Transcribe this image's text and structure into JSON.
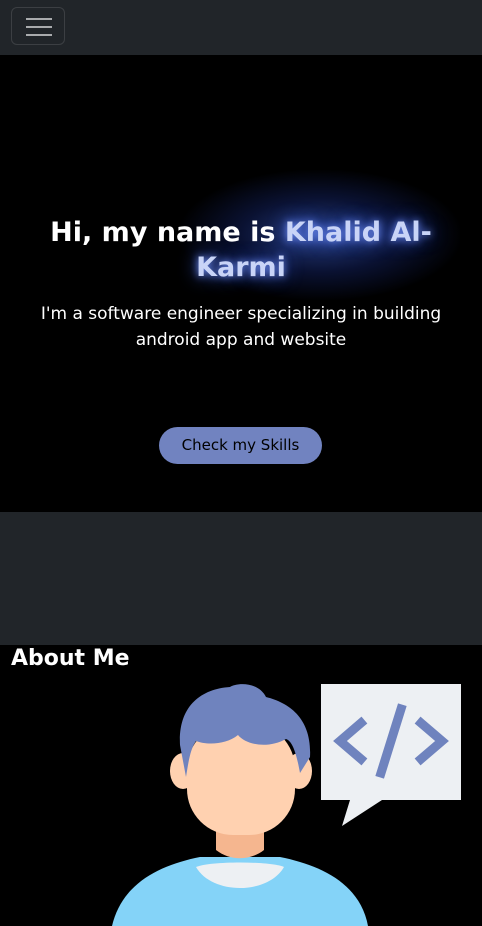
{
  "navbar": {
    "toggler_icon": "hamburger-menu-icon"
  },
  "hero": {
    "title_prefix": "Hi, my name is",
    "title_name": "Khalid Al-Karmi",
    "subtitle": "I'm a software engineer specializing in building android app and website",
    "cta_label": "Check my Skills"
  },
  "about": {
    "title": "About Me",
    "illustration": "developer-avatar-with-code-bubble",
    "code_icon": "code-brackets-icon"
  },
  "colors": {
    "nav_bg": "#212529",
    "accent": "#7183c0",
    "name_glow": "#3e63e8",
    "hair": "#6f83be",
    "skin": "#ffd1b0",
    "shirt": "#84d3f8"
  }
}
